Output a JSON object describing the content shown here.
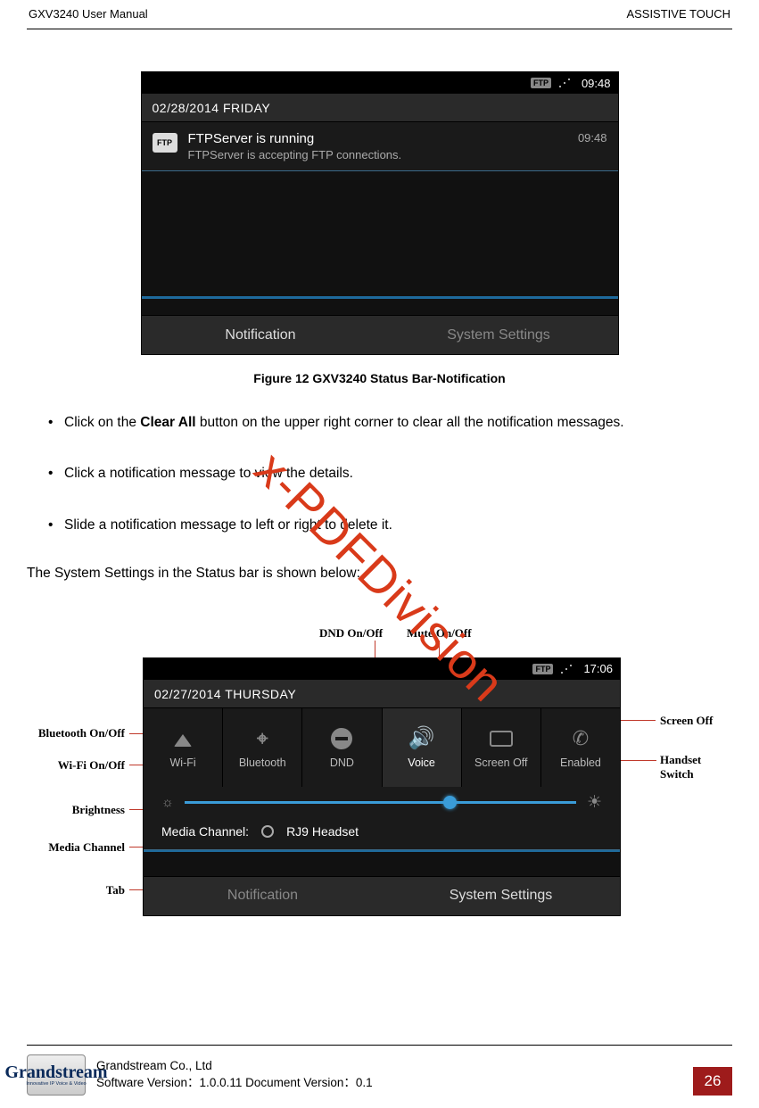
{
  "header": {
    "left": "GXV3240 User Manual",
    "right": "ASSISTIVE TOUCH"
  },
  "screenshot1": {
    "status": {
      "ftp": "FTP",
      "clock": "09:48"
    },
    "date": "02/28/2014 FRIDAY",
    "notification": {
      "title": "FTPServer is running",
      "subtitle": "FTPServer is accepting FTP connections.",
      "time": "09:48",
      "icon_label": "FTP"
    },
    "tabs": {
      "notification": "Notification",
      "system_settings": "System Settings"
    }
  },
  "figure_caption": "Figure 12 GXV3240 Status Bar-Notification",
  "bullets": {
    "b1_pre": "Click on the ",
    "b1_bold": "Clear All",
    "b1_post": " button on the upper right corner to clear all the notification messages.",
    "b2": "Click a notification message to view the details.",
    "b3": "Slide a notification message to left or right to delete it."
  },
  "paragraph": "The System Settings in the Status bar is shown below:",
  "watermark": "x-PDFDivision",
  "callouts": {
    "dnd": "DND On/Off",
    "mute": "Mute On/Off",
    "bluetooth": "Bluetooth On/Off",
    "wifi": "Wi-Fi On/Off",
    "brightness": "Brightness",
    "media": "Media Channel",
    "tab": "Tab",
    "screenoff": "Screen Off",
    "handset": "Handset Switch"
  },
  "screenshot2": {
    "status": {
      "ftp": "FTP",
      "clock": "17:06"
    },
    "date": "02/27/2014 THURSDAY",
    "items": {
      "wifi": "Wi-Fi",
      "bluetooth": "Bluetooth",
      "dnd": "DND",
      "voice": "Voice",
      "screen_off": "Screen Off",
      "enabled": "Enabled"
    },
    "media_label": "Media Channel:",
    "media_value": "RJ9 Headset",
    "tabs": {
      "notification": "Notification",
      "system_settings": "System Settings"
    }
  },
  "footer": {
    "company": "Grandstream Co., Ltd",
    "version": "Software Version：1.0.0.11 Document Version：0.1",
    "logo_top": "Grandstream",
    "logo_sub": "Innovative IP Voice & Video",
    "page_number": "26"
  }
}
